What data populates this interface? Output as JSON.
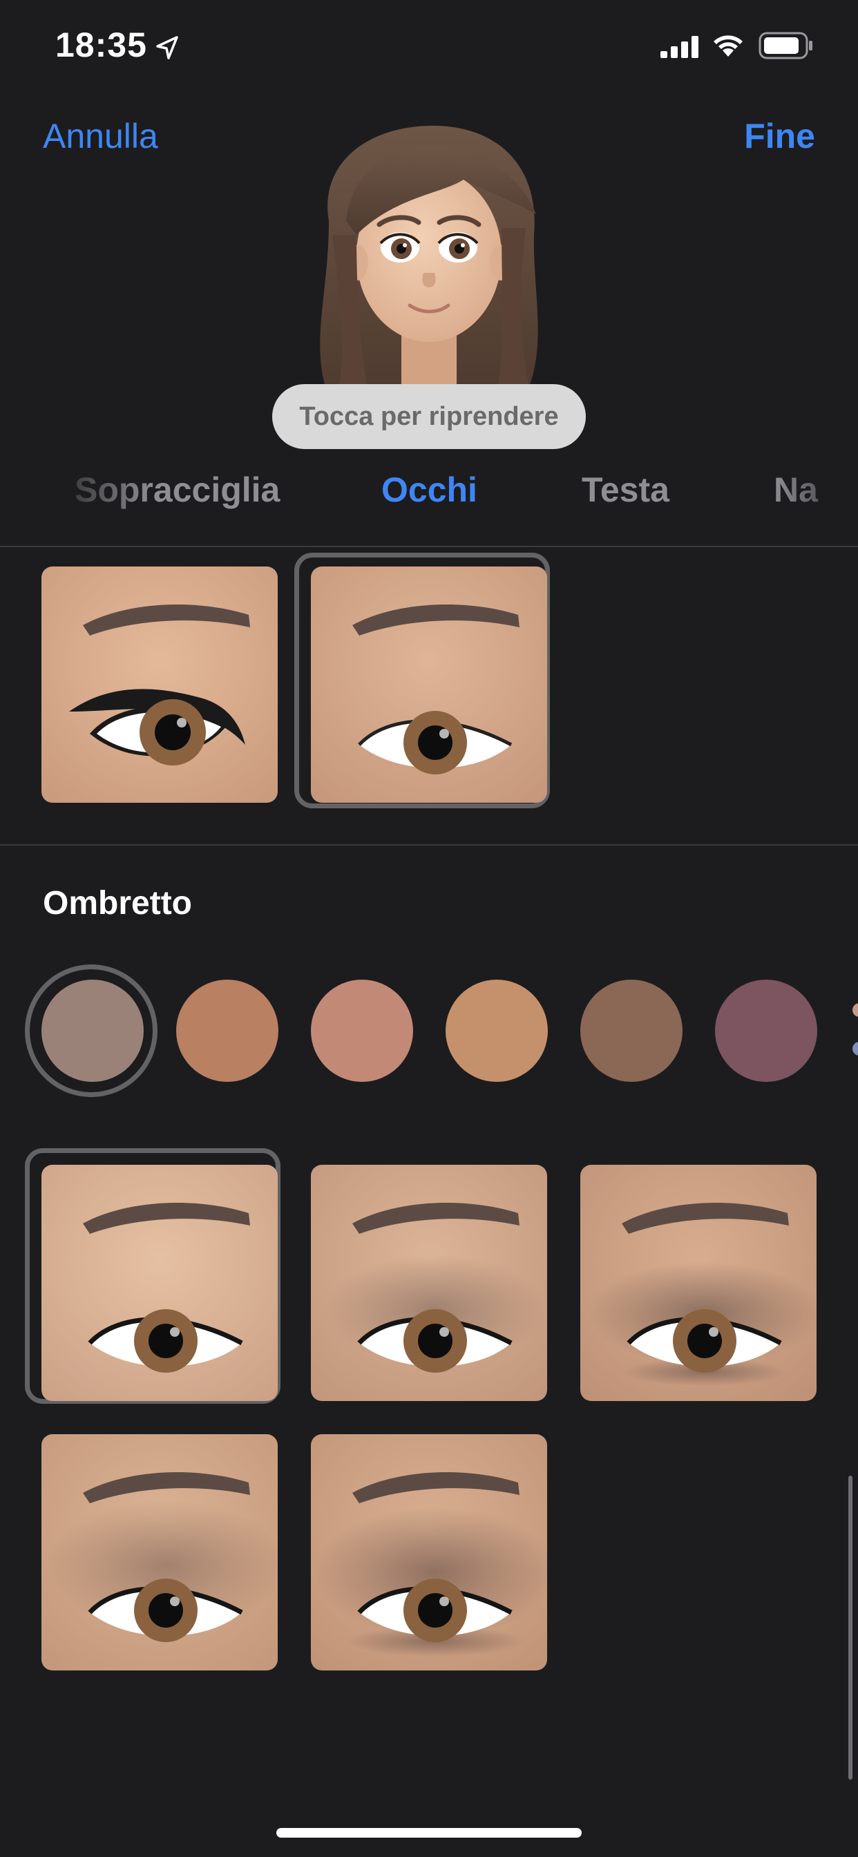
{
  "status_bar": {
    "time": "18:35",
    "icons": [
      "location-arrow-icon",
      "cellular-signal-icon",
      "wifi-icon",
      "battery-icon"
    ]
  },
  "nav": {
    "cancel_label": "Annulla",
    "done_label": "Fine"
  },
  "retake_label": "Tocca per riprendere",
  "tabs": [
    {
      "label": "Sopracciglia",
      "active": false
    },
    {
      "label": "Occhi",
      "active": true
    },
    {
      "label": "Testa",
      "active": false
    },
    {
      "label": "Na",
      "active": false
    }
  ],
  "eyeliner_options": [
    {
      "style": "winged-eyeliner",
      "selected": false
    },
    {
      "style": "no-eyeliner",
      "selected": true
    }
  ],
  "eyeshadow": {
    "section_title": "Ombretto",
    "colors": [
      "#9a8278",
      "#b98062",
      "#c38977",
      "#c5916c",
      "#8b6755",
      "#7c5560"
    ],
    "selected_color_index": 0,
    "options": [
      {
        "style": "none",
        "selected": true
      },
      {
        "style": "lid-shade",
        "selected": false
      },
      {
        "style": "smoky-crease",
        "selected": false
      },
      {
        "style": "soft-lid",
        "selected": false
      },
      {
        "style": "full-shade",
        "selected": false
      }
    ]
  },
  "accent_color": "#3f86f4"
}
